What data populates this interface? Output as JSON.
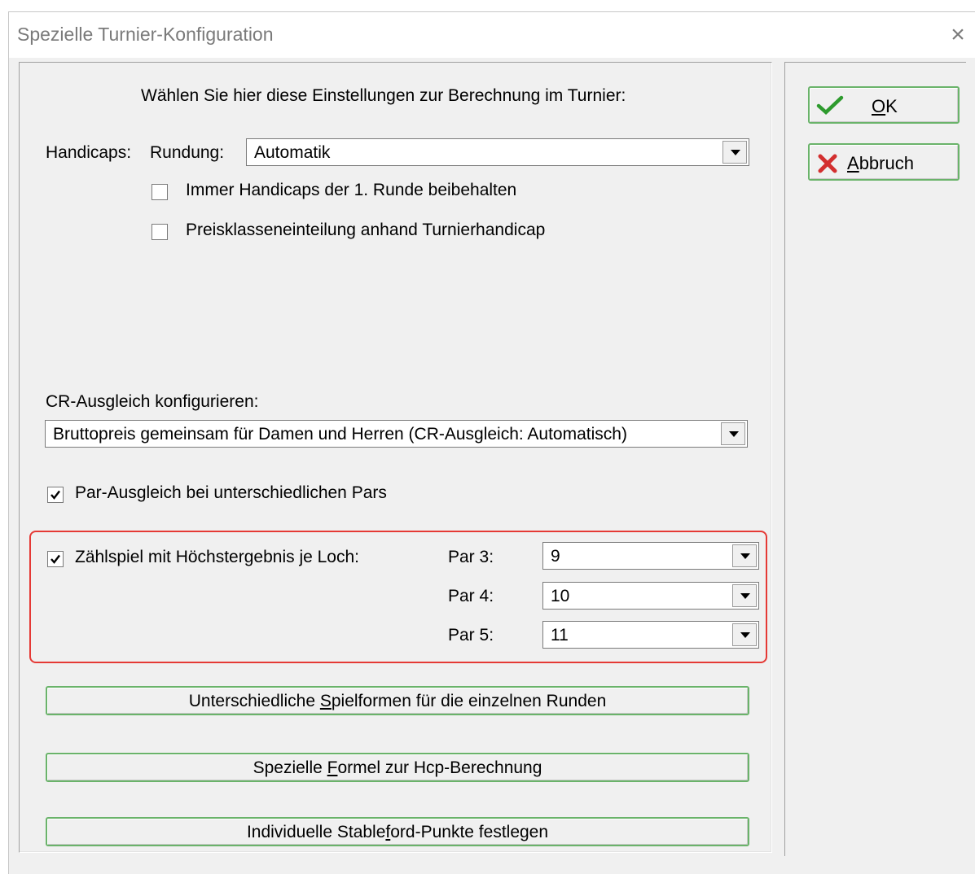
{
  "window": {
    "title": "Spezielle Turnier-Konfiguration",
    "close_glyph": "×"
  },
  "intro_text": "Wählen Sie hier diese Einstellungen zur Berechnung im Turnier:",
  "handicaps": {
    "label": "Handicaps:",
    "rounding_label": "Rundung:",
    "rounding_value": "Automatik",
    "keep_first_round": {
      "label": "Immer Handicaps der 1. Runde beibehalten",
      "checked": false
    },
    "price_class": {
      "label": "Preisklasseneinteilung anhand Turnierhandicap",
      "checked": false
    }
  },
  "cr": {
    "label": "CR-Ausgleich konfigurieren:",
    "value": "Bruttopreis gemeinsam für Damen und Herren (CR-Ausgleich: Automatisch)"
  },
  "par_ausgleich": {
    "label": "Par-Ausgleich bei unterschiedlichen Pars",
    "checked": true
  },
  "max_score": {
    "label": "Zählspiel mit Höchstergebnis je Loch:",
    "checked": true,
    "par3": {
      "label": "Par 3:",
      "value": "9"
    },
    "par4": {
      "label": "Par 4:",
      "value": "10"
    },
    "par5": {
      "label": "Par 5:",
      "value": "11"
    }
  },
  "buttons": {
    "spielformen": {
      "pre": "Unterschiedliche ",
      "key": "S",
      "post": "pielformen für die einzelnen Runden"
    },
    "formel": {
      "pre": "Spezielle ",
      "key": "F",
      "post": "ormel zur Hcp-Berechnung"
    },
    "stableford": {
      "pre": "Individuelle Stable",
      "key": "f",
      "post": "ord-Punkte festlegen"
    },
    "ok": {
      "key": "O",
      "post": "K"
    },
    "abbruch": {
      "key": "A",
      "post": "bbruch"
    }
  },
  "colors": {
    "highlight": "#e53935",
    "button_border": "#6ab36a",
    "ok_icon": "#2e9b2e",
    "cancel_icon": "#d32f2f"
  }
}
